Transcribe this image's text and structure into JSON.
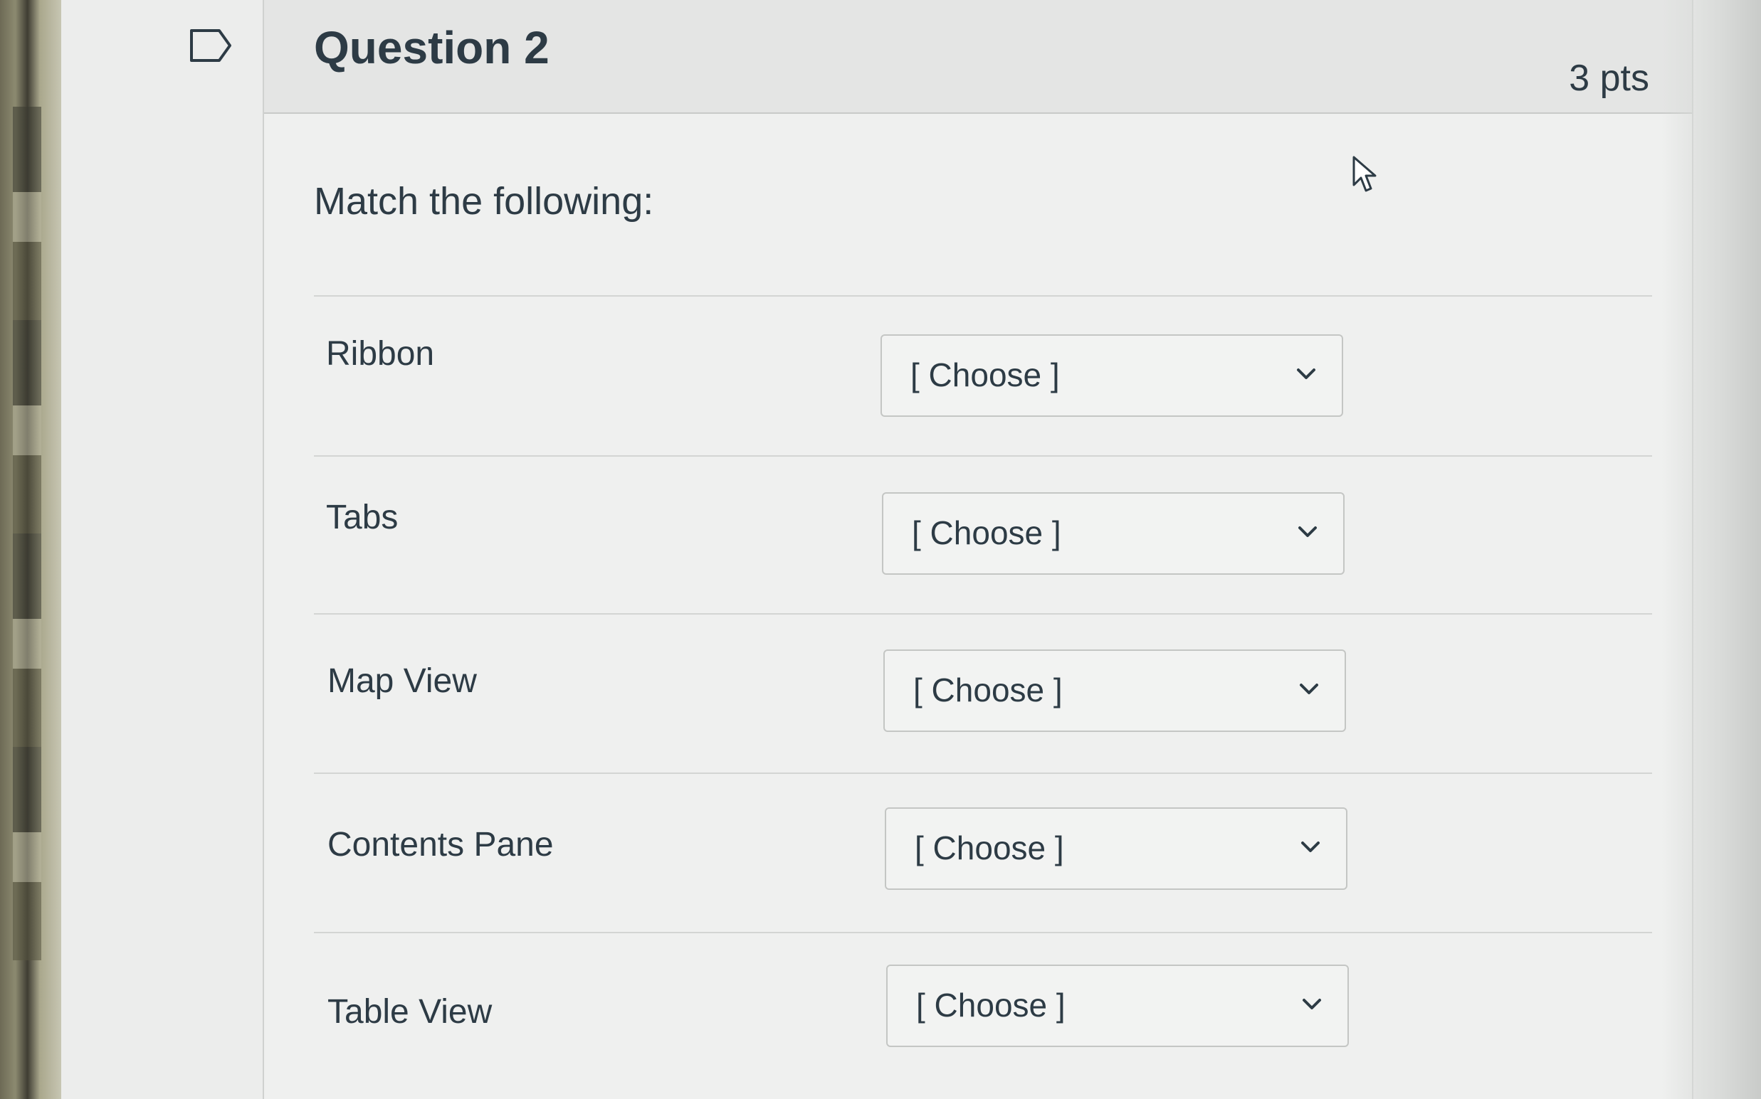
{
  "question": {
    "title": "Question 2",
    "points": "3 pts",
    "prompt": "Match the following:"
  },
  "matches": [
    {
      "label": "Ribbon",
      "selected": "[ Choose ]"
    },
    {
      "label": "Tabs",
      "selected": "[ Choose ]"
    },
    {
      "label": "Map View",
      "selected": "[ Choose ]"
    },
    {
      "label": "Contents Pane",
      "selected": "[ Choose ]"
    },
    {
      "label": "Table View",
      "selected": "[ Choose ]"
    }
  ],
  "icons": {
    "flag": "flag-outline-icon",
    "chevron": "chevron-down-icon",
    "cursor": "mouse-pointer-icon"
  },
  "colors": {
    "text": "#2d3b45",
    "header_bg": "#e4e5e4",
    "card_bg": "#eff0ef",
    "border": "#c4c6c4"
  }
}
